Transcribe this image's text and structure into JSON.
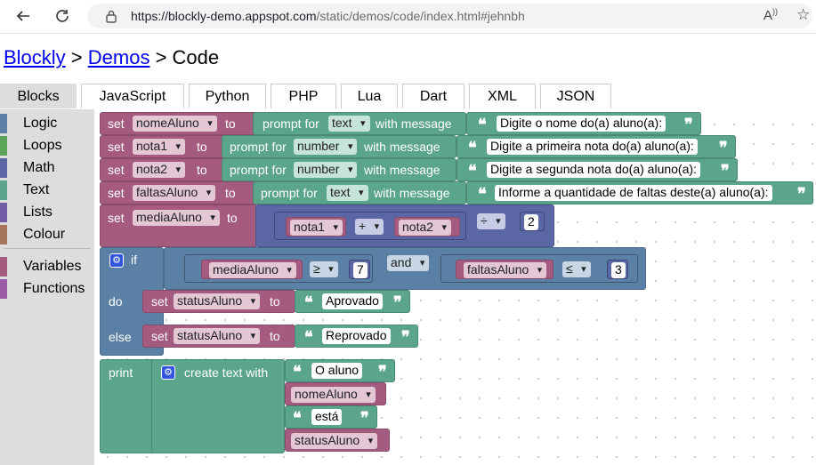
{
  "browser": {
    "url_host": "https://blockly-demo.appspot.com",
    "url_path": "/static/demos/code/index.html#jehnbh",
    "back_icon": "arrow-left-icon",
    "reload_icon": "reload-icon",
    "read_aloud_icon": "read-aloud-icon",
    "favorite_icon": "star-icon"
  },
  "header": {
    "crumb1": "Blockly",
    "sep1": " > ",
    "crumb2": "Demos",
    "sep2": " > ",
    "current": "Code"
  },
  "tabs": [
    "Blocks",
    "JavaScript",
    "Python",
    "PHP",
    "Lua",
    "Dart",
    "XML",
    "JSON"
  ],
  "active_tab": "Blocks",
  "toolbox": {
    "categories": [
      {
        "label": "Logic",
        "color": "#5b80a5"
      },
      {
        "label": "Loops",
        "color": "#5ba55b"
      },
      {
        "label": "Math",
        "color": "#5b67a5"
      },
      {
        "label": "Text",
        "color": "#5ba58c"
      },
      {
        "label": "Lists",
        "color": "#745ba5"
      },
      {
        "label": "Colour",
        "color": "#a5745b"
      },
      {
        "label": "Variables",
        "color": "#a55b80"
      },
      {
        "label": "Functions",
        "color": "#995ba5"
      }
    ]
  },
  "blocks": {
    "set": "set",
    "to": "to",
    "prompt_for": "prompt for",
    "with_message": "with message",
    "assign1": {
      "var": "nomeAluno",
      "type": "text",
      "message": "Digite o nome do(a) aluno(a):"
    },
    "assign2": {
      "var": "nota1",
      "type": "number",
      "message": "Digite a primeira nota do(a) aluno(a):"
    },
    "assign3": {
      "var": "nota2",
      "type": "number",
      "message": "Digite a segunda nota do(a) aluno(a):"
    },
    "assign4": {
      "var": "faltasAluno",
      "type": "text",
      "message": "Informe a quantidade de faltas deste(a) aluno(a):"
    },
    "assign5": {
      "var": "mediaAluno",
      "a": "nota1",
      "op1": "+",
      "b": "nota2",
      "op2": "÷",
      "divisor": "2"
    },
    "if_label": "if",
    "do_label": "do",
    "else_label": "else",
    "cond": {
      "var": "mediaAluno",
      "cmp1": "≥",
      "val1": "7",
      "and": "and",
      "var2": "faltasAluno",
      "cmp2": "≤",
      "val2": "3"
    },
    "do_set": {
      "var": "statusAluno",
      "value": "Aprovado"
    },
    "else_set": {
      "var": "statusAluno",
      "value": "Reprovado"
    },
    "print": "print",
    "create_text": "create text with",
    "items": {
      "t1": "O aluno",
      "v1": "nomeAluno",
      "t2": "está",
      "v2": "statusAluno"
    },
    "quote_open": "❝",
    "quote_close": "❞"
  },
  "colors": {
    "variable": "#a55b80",
    "text": "#5ba58c",
    "math": "#5b67a5",
    "logic": "#5b80a5",
    "link": "#0000ee"
  }
}
